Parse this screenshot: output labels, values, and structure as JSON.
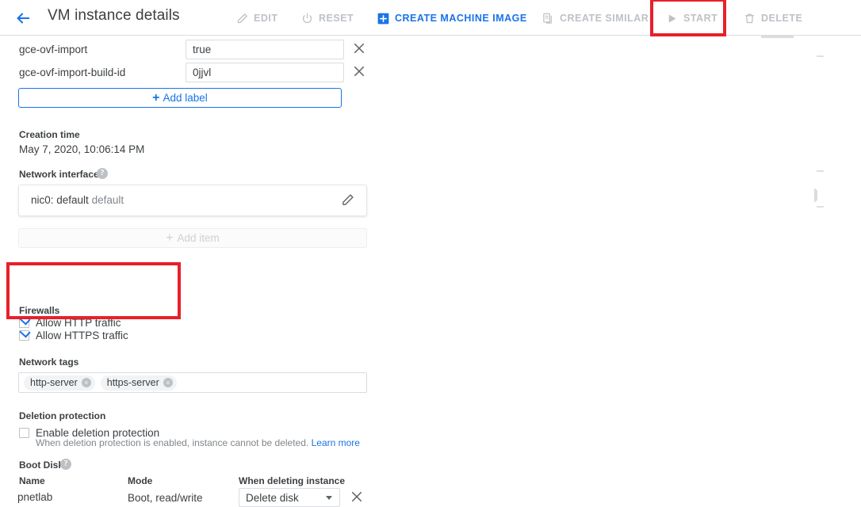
{
  "header": {
    "back_icon": "arrow-back-icon",
    "title": "VM instance details",
    "actions": [
      {
        "id": "edit",
        "label": "EDIT",
        "icon": "pencil-icon",
        "state": "disabled"
      },
      {
        "id": "reset",
        "label": "RESET",
        "icon": "power-reset-icon",
        "state": "disabled"
      },
      {
        "id": "create-machine-image",
        "label": "CREATE MACHINE IMAGE",
        "icon": "plus-square-icon",
        "state": "enabled"
      },
      {
        "id": "create-similar",
        "label": "CREATE SIMILAR",
        "icon": "copy-icon",
        "state": "disabled"
      },
      {
        "id": "start",
        "label": "START",
        "icon": "play-icon",
        "state": "disabled"
      },
      {
        "id": "delete",
        "label": "DELETE",
        "icon": "trash-icon",
        "state": "disabled"
      }
    ]
  },
  "annotations": {
    "color": "#e8202a",
    "boxes": [
      {
        "id": "start-highlight",
        "target": "START toolbar button"
      },
      {
        "id": "firewalls-highlight",
        "target": "Firewalls checkboxes"
      }
    ]
  },
  "labels": {
    "rows": [
      {
        "key": "gce-ovf-import",
        "value": "true",
        "remove_icon": "close-icon"
      },
      {
        "key": "gce-ovf-import-build-id",
        "value": "0jjvl",
        "remove_icon": "close-icon"
      }
    ],
    "add_label_button": "Add label",
    "add_icon": "plus-icon"
  },
  "creation_time": {
    "label": "Creation time",
    "value": "May 7, 2020, 10:06:14 PM"
  },
  "network_interfaces": {
    "label": "Network interfaces",
    "help_icon": "help-icon",
    "help_glyph": "?",
    "item_name": "nic0: default",
    "item_sub": "default",
    "edit_icon": "pencil-icon",
    "add_item_label": "Add item",
    "add_icon": "plus-icon"
  },
  "firewalls": {
    "label": "Firewalls",
    "options": [
      {
        "label": "Allow HTTP traffic",
        "checked": true
      },
      {
        "label": "Allow HTTPS traffic",
        "checked": true
      }
    ]
  },
  "network_tags": {
    "label": "Network tags",
    "tags": [
      {
        "name": "http-server",
        "remove_icon": "chip-close-icon",
        "remove_glyph": "×"
      },
      {
        "name": "https-server",
        "remove_icon": "chip-close-icon",
        "remove_glyph": "×"
      }
    ]
  },
  "deletion_protection": {
    "label": "Deletion protection",
    "checkbox_label": "Enable deletion protection",
    "checked": false,
    "note": "When deletion protection is enabled, instance cannot be deleted.",
    "learn_more": "Learn more"
  },
  "boot_disk": {
    "label": "Boot Disk",
    "help_icon": "help-icon",
    "help_glyph": "?",
    "columns": [
      "Name",
      "Mode",
      "When deleting instance"
    ],
    "row": {
      "name": "pnetlab",
      "mode": "Boot, read/write",
      "when_deleting": "Delete disk"
    },
    "dropdown_icon": "chevron-down-icon",
    "remove_icon": "close-icon"
  }
}
